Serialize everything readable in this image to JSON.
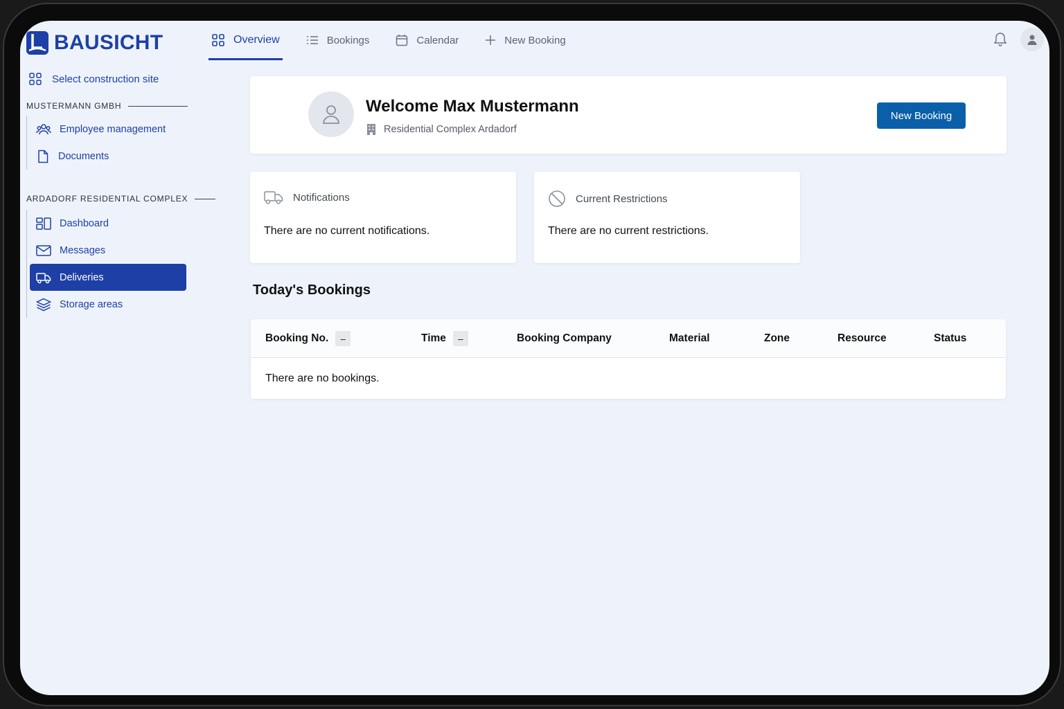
{
  "app": {
    "brand": "BAUSICHT",
    "brand_color": "#1d3fa6"
  },
  "topnav": {
    "tabs": [
      {
        "label": "Overview",
        "icon": "grid-icon",
        "active": true
      },
      {
        "label": "Bookings",
        "icon": "list-icon"
      },
      {
        "label": "Calendar",
        "icon": "calendar-icon"
      },
      {
        "label": "New Booking",
        "icon": "plus-icon"
      }
    ]
  },
  "sidebar": {
    "select_site": "Select construction site",
    "company_heading": "MUSTERMANN GMBH",
    "company_items": [
      {
        "label": "Employee management",
        "icon": "users-icon"
      },
      {
        "label": "Documents",
        "icon": "document-icon"
      }
    ],
    "site_heading": "ARDADORF RESIDENTIAL COMPLEX",
    "site_items": [
      {
        "label": "Dashboard",
        "icon": "dashboard-icon"
      },
      {
        "label": "Messages",
        "icon": "mail-icon"
      },
      {
        "label": "Deliveries",
        "icon": "truck-icon",
        "active": true
      },
      {
        "label": "Storage areas",
        "icon": "layers-icon"
      }
    ]
  },
  "welcome": {
    "title": "Welcome Max Mustermann",
    "site": "Residential Complex Ardadorf",
    "button": "New Booking"
  },
  "notifications": {
    "title": "Notifications",
    "body": "There are no current notifications."
  },
  "restrictions": {
    "title": "Current Restrictions",
    "body": "There are no current restrictions."
  },
  "bookings": {
    "title": "Today's Bookings",
    "columns": [
      "Booking No.",
      "Time",
      "Booking Company",
      "Material",
      "Zone",
      "Resource",
      "Status"
    ],
    "sort_symbol": "–",
    "empty": "There are no bookings."
  }
}
